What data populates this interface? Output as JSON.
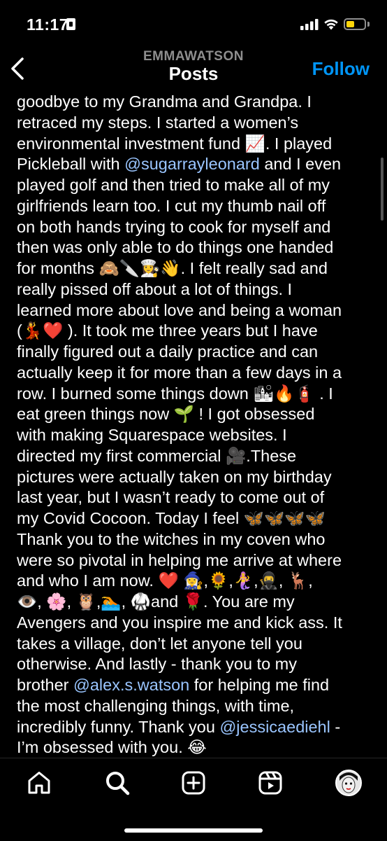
{
  "status_bar": {
    "time": "11:17"
  },
  "header": {
    "username": "EMMAWATSON",
    "title": "Posts",
    "follow_label": "Follow"
  },
  "caption": {
    "lines": [
      "goodbye to my Grandma and Grandpa. I",
      "retraced my steps. I started a women’s",
      "environmental investment fund 📈. I played",
      "Pickleball with @sugarrayleonard and I even",
      "played golf and then tried to make all of my",
      "girlfriends learn too. I cut my thumb nail off",
      "on both hands trying to cook for myself and",
      "then was only able to do things one handed",
      "for months 🙈🔪👩‍🍳👋. I felt really sad and",
      "really pissed off about a lot of things. I",
      "learned more about love and being a woman",
      "(💃❤️ ). It took me three years but I have",
      "finally figured out a daily practice and can",
      "actually keep it for more than a few days in a",
      "row. I burned some things down 🏙🔥🧯 . I",
      "eat green things now 🌱 ! I got obsessed",
      "with making Squarespace websites. I",
      "directed my first commercial 🎥.These",
      "pictures were actually taken on my birthday",
      "last year, but I wasn’t ready to come out of",
      "my Covid Cocoon. Today I feel 🦋🦋🦋🦋",
      "Thank you to the witches in my coven who",
      "were so pivotal in helping me arrive at where",
      "and who I am now. ❤️ 🧙‍♀️,🌻,🧜‍♀️,🥷, 🦌,",
      "👁️, 🌸, 🦉,🏊, 🥋and 🌹. You are my",
      "Avengers and you inspire me and kick ass. It",
      "takes a village, don’t let anyone tell you",
      "otherwise. And lastly -  thank you to my",
      "brother @alex.s.watson for helping me find",
      "the most challenging things, with time,",
      "incredibly funny. Thank you @jessicaediehl -",
      "I’m obsessed with you. 😂"
    ]
  },
  "tab_bar": {
    "icons": [
      "home-icon",
      "search-icon",
      "create-post-icon",
      "reels-icon",
      "profile-avatar"
    ]
  },
  "colors": {
    "link": "#0095f6",
    "mention": "#9ac5ff",
    "background": "#000000",
    "battery": "#ffd60a"
  }
}
